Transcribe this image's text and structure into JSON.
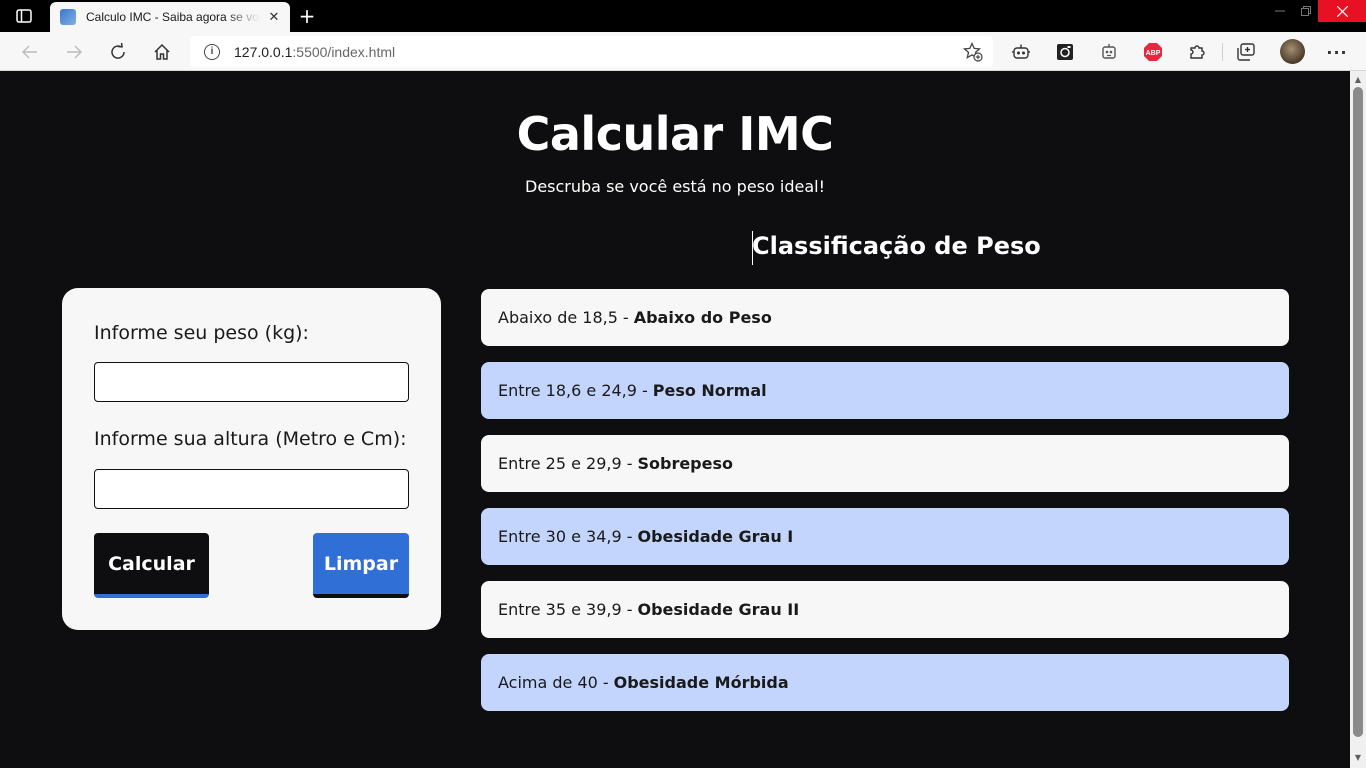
{
  "browser": {
    "tab_title": "Calculo IMC - Saiba agora se você",
    "url_host": "127.0.0.1",
    "url_path": ":5500/index.html"
  },
  "page": {
    "title": "Calcular IMC",
    "subtitle": "Descruba se você está no peso ideal!",
    "form": {
      "weight_label": "Informe seu peso (kg):",
      "weight_value": "",
      "height_label": "Informe sua altura (Metro e Cm):",
      "height_value": "",
      "calculate_button": "Calcular",
      "clear_button": "Limpar"
    },
    "classification": {
      "title": "Classificação de Peso",
      "items": [
        {
          "range": "Abaixo de 18,5",
          "label": "Abaixo do Peso"
        },
        {
          "range": "Entre 18,6 e 24,9",
          "label": "Peso Normal"
        },
        {
          "range": "Entre 25 e 29,9",
          "label": "Sobrepeso"
        },
        {
          "range": "Entre 30 e 34,9",
          "label": "Obesidade Grau I"
        },
        {
          "range": "Entre 35 e 39,9",
          "label": "Obesidade Grau II"
        },
        {
          "range": "Acima de 40",
          "label": "Obesidade Mórbida"
        }
      ]
    }
  },
  "colors": {
    "page_background": "#0e0e10",
    "card_background": "#f7f7f7",
    "accent_blue": "#2f6fd6",
    "highlight_row": "#c3d5fd"
  }
}
